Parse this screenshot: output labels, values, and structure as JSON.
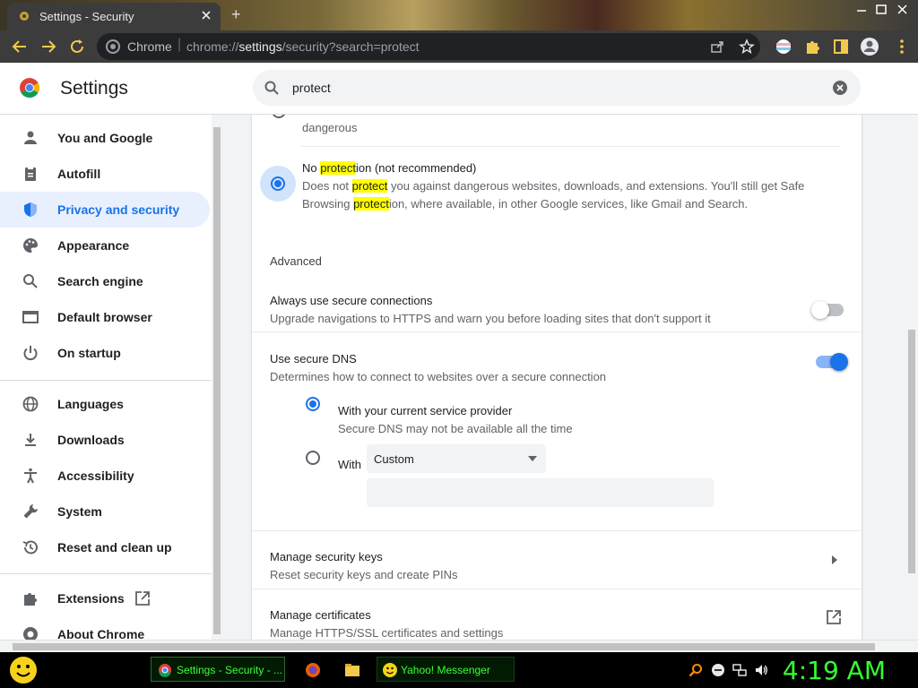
{
  "window": {
    "tab_title": "Settings - Security",
    "controls": "- ▢ ✕"
  },
  "toolbar": {
    "site_label": "Chrome",
    "url_prefix": "chrome://",
    "url_host": "settings",
    "url_path": "/security?search=protect"
  },
  "settings": {
    "title": "Settings",
    "search_value": "protect"
  },
  "sidebar": {
    "items": [
      {
        "label": "You and Google",
        "icon": "person-icon"
      },
      {
        "label": "Autofill",
        "icon": "clipboard-icon"
      },
      {
        "label": "Privacy and security",
        "icon": "shield-icon",
        "active": true
      },
      {
        "label": "Appearance",
        "icon": "palette-icon"
      },
      {
        "label": "Search engine",
        "icon": "search-icon"
      },
      {
        "label": "Default browser",
        "icon": "browser-icon"
      },
      {
        "label": "On startup",
        "icon": "power-icon"
      },
      {
        "label": "Languages",
        "icon": "globe-icon"
      },
      {
        "label": "Downloads",
        "icon": "download-icon"
      },
      {
        "label": "Accessibility",
        "icon": "accessibility-icon"
      },
      {
        "label": "System",
        "icon": "wrench-icon"
      },
      {
        "label": "Reset and clean up",
        "icon": "history-icon"
      },
      {
        "label": "Extensions",
        "icon": "puzzle-icon"
      },
      {
        "label": "About Chrome",
        "icon": "chrome-icon"
      }
    ]
  },
  "content": {
    "prev_option_tail": "dangerous",
    "no_protection": {
      "title_pre": "No ",
      "title_hl": "protect",
      "title_post": "ion (not recommended)",
      "line1_pre": "Does not ",
      "line1_hl": "protect",
      "line1_post": " you against dangerous websites, downloads, and extensions. You'll still get Safe",
      "line2_pre": "Browsing ",
      "line2_hl": "protect",
      "line2_post": "ion, where available, in other Google services, like Gmail and Search.",
      "selected": true
    },
    "advanced_heading": "Advanced",
    "secure_connections": {
      "title": "Always use secure connections",
      "desc": "Upgrade navigations to HTTPS and warn you before loading sites that don't support it",
      "enabled": false
    },
    "secure_dns": {
      "title": "Use secure DNS",
      "desc": "Determines how to connect to websites over a secure connection",
      "enabled": true,
      "option_provider": "With your current service provider",
      "option_provider_desc": "Secure DNS may not be available all the time",
      "option_with": "With",
      "custom_select": "Custom",
      "custom_input": ""
    },
    "security_keys": {
      "title": "Manage security keys",
      "desc": "Reset security keys and create PINs"
    },
    "certificates": {
      "title": "Manage certificates",
      "desc": "Manage HTTPS/SSL certificates and settings"
    }
  },
  "taskbar": {
    "items": [
      "Settings - Security - ...",
      "Yahoo! Messenger"
    ],
    "clock": "4:19 AM"
  },
  "colors": {
    "accent": "#1a73e8",
    "highlight": "#ffff00",
    "taskbar_text": "#33ff33"
  }
}
